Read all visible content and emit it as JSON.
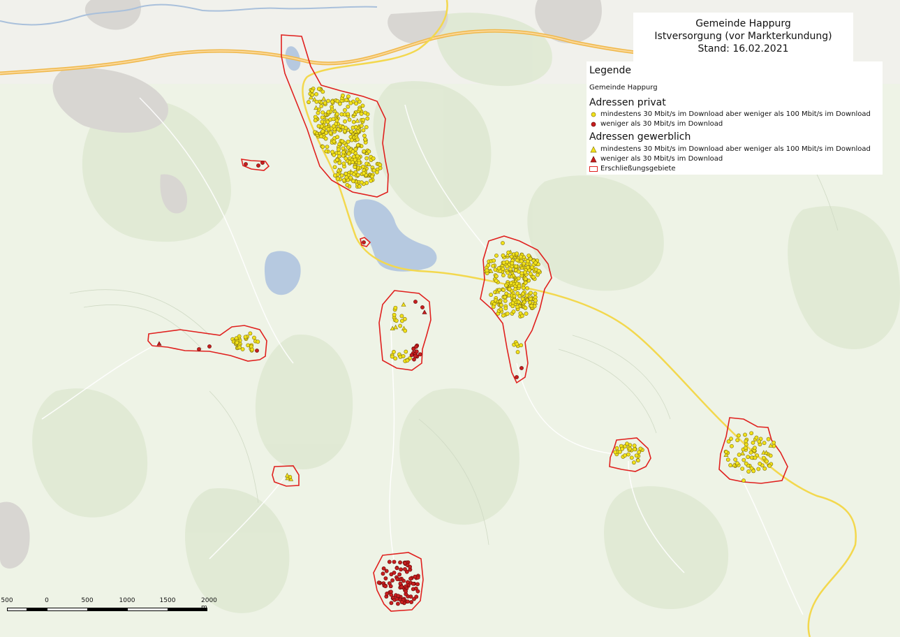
{
  "title": {
    "line1": "Gemeinde Happurg",
    "line2": "Istversorgung (vor Markterkundung)",
    "line3": "Stand: 16.02.2021"
  },
  "legend": {
    "heading": "Legende",
    "municipality": "Gemeinde Happurg",
    "private_heading": "Adressen privat",
    "private_items": [
      {
        "label": "mindestens 30 Mbit/s im Download aber weniger als 100 Mbit/s im Download",
        "color": "#f2e21a",
        "shape": "circle"
      },
      {
        "label": "weniger als 30 Mbit/s im Download",
        "color": "#c81e1e",
        "shape": "circle"
      }
    ],
    "commercial_heading": "Adressen gewerblich",
    "commercial_items": [
      {
        "label": "mindestens 30 Mbit/s im Download aber weniger als 100 Mbit/s im Download",
        "color": "#f2e21a",
        "shape": "triangle"
      },
      {
        "label": "weniger als 30 Mbit/s im Download",
        "color": "#c81e1e",
        "shape": "triangle"
      }
    ],
    "area_item": {
      "label": "Erschließungsgebiete",
      "color": "#e0201e"
    }
  },
  "scalebar": {
    "labels": [
      "500",
      "0",
      "500",
      "1000",
      "1500",
      "2000 m"
    ]
  },
  "colors": {
    "yellow": "#f2e21a",
    "red": "#c81e1e",
    "outline": "#e0201e",
    "water": "#b6c9e0",
    "road": "#f3d84e",
    "highway": "#f0b84a"
  }
}
